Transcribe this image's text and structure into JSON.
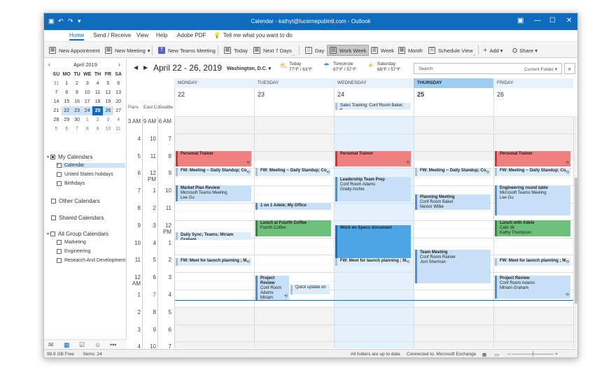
{
  "titlebar": {
    "title": "Calendar - kathyt@lucernepubintl.com  -  Outlook",
    "restore": "▣",
    "min": "—",
    "max": "☐",
    "close": "✕"
  },
  "menu": [
    "Home",
    "Send / Receive",
    "View",
    "Help",
    "Adobe PDF",
    "Tell me what you want to do"
  ],
  "ribbon": {
    "new_appointment": "New Appointment",
    "new_meeting": "New Meeting",
    "new_teams_meeting": "New Teams Meeting",
    "today": "Today",
    "next7": "Next 7 Days",
    "day": "Day",
    "work_week": "Work Week",
    "week": "Week",
    "month": "Month",
    "schedule_view": "Schedule View",
    "add": "Add",
    "share": "Share"
  },
  "mini_calendar": {
    "title": "April 2019",
    "headers": [
      "SU",
      "MO",
      "TU",
      "WE",
      "TH",
      "FR",
      "SA"
    ],
    "weeks": [
      [
        "31",
        "1",
        "2",
        "3",
        "4",
        "5",
        "6"
      ],
      [
        "7",
        "8",
        "9",
        "10",
        "11",
        "12",
        "13"
      ],
      [
        "14",
        "15",
        "16",
        "17",
        "18",
        "19",
        "20"
      ],
      [
        "21",
        "22",
        "23",
        "24",
        "25",
        "26",
        "27"
      ],
      [
        "28",
        "29",
        "30",
        "1",
        "2",
        "3",
        "4"
      ],
      [
        "5",
        "6",
        "7",
        "8",
        "9",
        "10",
        "11"
      ]
    ]
  },
  "folders": {
    "my_calendars": "My Calendars",
    "calendar": "Calendar",
    "us_holidays": "United States holidays",
    "birthdays": "Birthdays",
    "other": "Other Calendars",
    "shared": "Shared Calendars",
    "all_group": "All Group Calendars",
    "marketing": "Marketing",
    "engineering": "Engineering",
    "research": "Research And Development"
  },
  "header": {
    "range": "April 22 - 26, 2019",
    "location": "Washington, D.C.",
    "weather": [
      {
        "label": "Today",
        "temp": "77°F / 63°F"
      },
      {
        "label": "Tomorrow",
        "temp": "67°F / 57°F"
      },
      {
        "label": "Saturday",
        "temp": "68°F / 57°F"
      }
    ],
    "search_placeholder": "Search",
    "search_scope": "Current Folder"
  },
  "timezones": [
    "Paris",
    "East Co",
    "Seattle"
  ],
  "days": [
    {
      "name": "MONDAY",
      "num": "22"
    },
    {
      "name": "TUESDAY",
      "num": "23"
    },
    {
      "name": "WEDNESDAY",
      "num": "24"
    },
    {
      "name": "THURSDAY",
      "num": "25"
    },
    {
      "name": "FRIDAY",
      "num": "26"
    }
  ],
  "allday_event": "Sales Training; Conf Room Baker; K...",
  "time_rows": [
    [
      "3 AM",
      "9 AM",
      "6 AM"
    ],
    [
      "4",
      "10",
      "7"
    ],
    [
      "5",
      "11",
      "8"
    ],
    [
      "6",
      "12 PM",
      "9"
    ],
    [
      "7",
      "1",
      "10"
    ],
    [
      "8",
      "2",
      "11"
    ],
    [
      "9",
      "3",
      "12 PM"
    ],
    [
      "10",
      "4",
      "1"
    ],
    [
      "11",
      "5",
      "2"
    ],
    [
      "12 AM",
      "6",
      "3"
    ],
    [
      "1",
      "7",
      "4"
    ],
    [
      "2",
      "8",
      "5"
    ],
    [
      "3",
      "9",
      "6"
    ],
    [
      "4",
      "10",
      "7"
    ]
  ],
  "events": {
    "personal_trainer": "Personal Trainer",
    "fw_standup": "FW: Meeting -- Daily Standup; Co",
    "market_plan": [
      "Market Plan Review",
      "Microsoft Teams Meeting",
      "Lee Gu"
    ],
    "daily_sync": "Daily Sync; Teams; Miriam Graham",
    "fw_launch": "FW: Meet for launch planning ; M",
    "one_on_one": "1 on 1 Adele; My Office",
    "lunch_fourth": [
      "Lunch at Fourth Coffee",
      "Fourth Coffee"
    ],
    "project_review_tue": [
      "Project Review",
      "Conf Room",
      "Adams",
      "Miriam Graham"
    ],
    "quick_update": "Quick update on",
    "leadership": [
      "Leadership Team Prep",
      "Conf Room Adams",
      "Grady Archie"
    ],
    "work_specs": "Work on Specs document",
    "planning": [
      "Planning Meeting",
      "Conf Room Baker",
      "Nestor Wilke"
    ],
    "team_meeting": [
      "Team Meeting",
      "Conf Room Rainier",
      "Joni Sherman"
    ],
    "engineering": [
      "Engineering round table",
      "Microsoft Teams Meeting",
      "Lee Gu"
    ],
    "lunch_adele": [
      "Lunch with Adele",
      "Cafe 36",
      "Kathy Thompson"
    ],
    "project_review_fri": [
      "Project Review",
      "Conf Room Adams",
      "Miriam Graham"
    ]
  },
  "status": {
    "free": "98.9 GB Free",
    "items": "Items: 24",
    "sync": "All folders are up to date.",
    "conn": "Connected to: Microsoft Exchange"
  }
}
